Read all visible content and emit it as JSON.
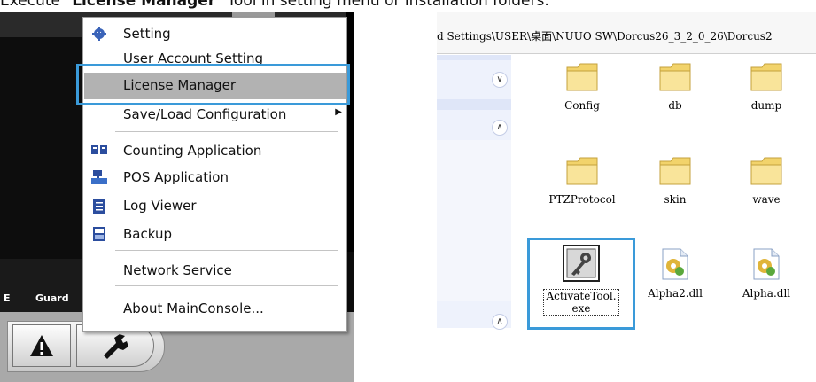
{
  "caption": {
    "prefix": "Execute \"",
    "bold": "License Manager",
    "suffix": "\" Tool in setting menu or installation folders."
  },
  "app": {
    "tab_e": "E",
    "tab_guard": "Guard"
  },
  "menu": {
    "items": [
      {
        "label": "Setting",
        "icon": "gear-icon"
      },
      {
        "label": "User Account Setting",
        "icon": ""
      },
      {
        "label": "License Manager",
        "icon": "",
        "highlighted": true
      },
      {
        "label": "Save/Load Configuration",
        "icon": "",
        "submenu": true
      },
      {
        "label": "Counting Application",
        "icon": "counting-icon"
      },
      {
        "label": "POS Application",
        "icon": "pos-icon"
      },
      {
        "label": "Log Viewer",
        "icon": "log-icon"
      },
      {
        "label": "Backup",
        "icon": "backup-icon"
      },
      {
        "label": "Network Service",
        "icon": ""
      },
      {
        "label": "About MainConsole...",
        "icon": ""
      }
    ]
  },
  "explorer": {
    "address": "d Settings\\USER\\桌面\\NUUO SW\\Dorcus26_3_2_0_26\\Dorcus2",
    "files": [
      {
        "name": "Config",
        "type": "folder"
      },
      {
        "name": "db",
        "type": "folder"
      },
      {
        "name": "dump",
        "type": "folder"
      },
      {
        "name": "PTZProtocol",
        "type": "folder"
      },
      {
        "name": "skin",
        "type": "folder"
      },
      {
        "name": "wave",
        "type": "folder"
      },
      {
        "name": "ActivateTool.exe",
        "type": "exe",
        "selected": true
      },
      {
        "name": "Alpha2.dll",
        "type": "dll"
      },
      {
        "name": "Alpha.dll",
        "type": "dll"
      }
    ]
  },
  "colors": {
    "highlight_box": "#3a9ad9",
    "menu_highlight": "#b2b2b2",
    "folder": "#f7dc7a"
  }
}
